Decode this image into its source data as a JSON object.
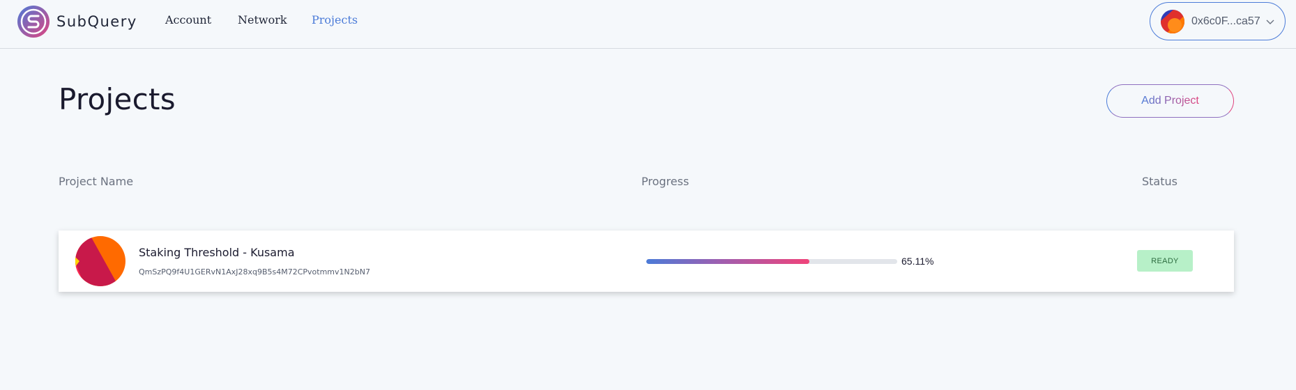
{
  "header": {
    "brand": "SubQuery",
    "nav": [
      {
        "label": "Account"
      },
      {
        "label": "Network"
      },
      {
        "label": "Projects"
      }
    ],
    "wallet": {
      "address": "0x6c0F...ca57"
    }
  },
  "main": {
    "title": "Projects",
    "add_project_label": "Add Project",
    "columns": {
      "name": "Project Name",
      "progress": "Progress",
      "status": "Status"
    },
    "projects": [
      {
        "name": "Staking Threshold - Kusama",
        "id": "QmSzPQ9f4U1GERvN1AxJ28xq9B5s4M72CPvotmmv1N2bN7",
        "progress_pct": 65.11,
        "progress_label": "65.11%",
        "status": "READY"
      }
    ]
  },
  "colors": {
    "accent_blue": "#4b7bd8",
    "accent_pink": "#e0447e",
    "status_ready_bg": "#b7f0c8"
  },
  "icons": {
    "brand": "subquery-logo-icon",
    "wallet_avatar": "identicon-icon",
    "chevron": "chevron-down-icon",
    "project_avatar": "project-avatar-icon"
  }
}
